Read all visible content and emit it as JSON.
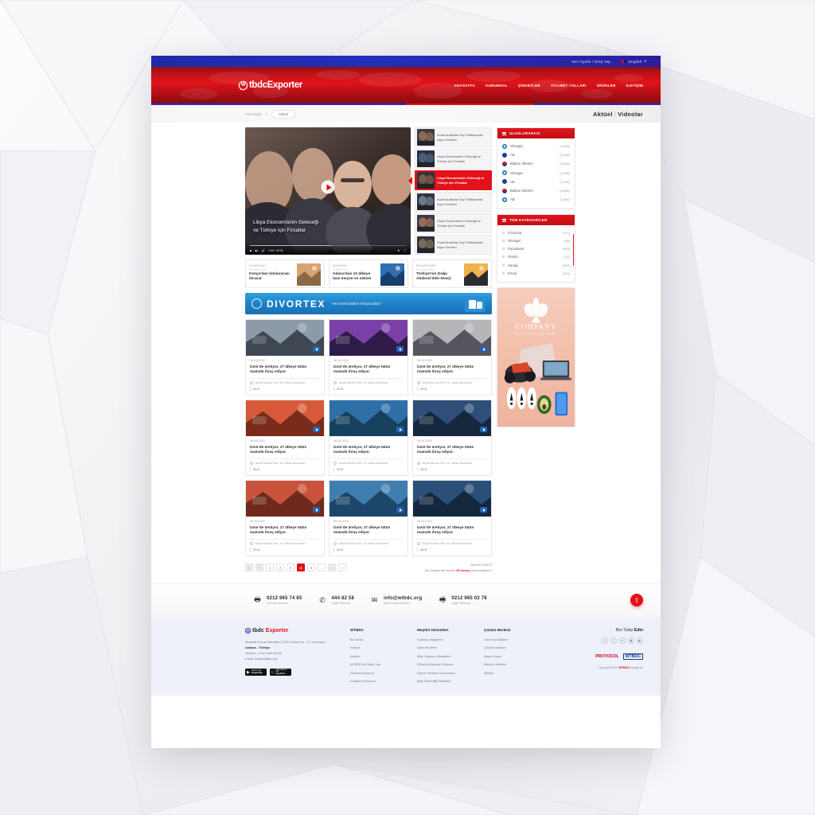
{
  "topbar": {
    "membership": "Yeni Üyelik / Giriş Yap",
    "language": "English",
    "caret": "▾"
  },
  "header": {
    "logo_mark": "W",
    "logo_text": "tbdcExporter",
    "nav": [
      {
        "label": "ANASAYFA"
      },
      {
        "label": "KURUMSAL"
      },
      {
        "label": "ŞİRKETLER"
      },
      {
        "label": "TİCARET YOLLARI"
      },
      {
        "label": "ÜRÜNLER"
      },
      {
        "label": "İLETİŞİM"
      }
    ]
  },
  "breadcrumb": {
    "home": "Ana Sayfa",
    "sep": ">",
    "current": "Aktüel"
  },
  "page_title": {
    "first": "Aktüel",
    "sep": "/",
    "second": "Videolar"
  },
  "player": {
    "title_line1": "Libya Ekonomisinin Geleceği",
    "title_line2": "ve Türkiye için Fırsatlar",
    "time": "1:00 / 40:31",
    "play_icon": "play-icon",
    "next_icon": "▶|",
    "volume_icon": "🔊",
    "settings_icon": "⚙",
    "fullscreen_icon": "⛶"
  },
  "playlist": [
    {
      "title": "Suudi Arabistan Dış Politikasında Asya Yönelimi",
      "active": false
    },
    {
      "title": "Libya Ekonomisinin Geleceği ve Türkiye için Fırsatlar",
      "active": false
    },
    {
      "title": "Libya Ekonomisinin Geleceği ve Türkiye için Fırsatlar",
      "active": true
    },
    {
      "title": "Suudi Arabistan Dış Politikasında Asya Yönelimi",
      "active": false
    },
    {
      "title": "Libya Ekonomisinin Geleceği ve Türkiye için Fırsatlar",
      "active": false
    },
    {
      "title": "Suudi Arabistan Dış Politikasında Asya Yönelimi",
      "active": false
    }
  ],
  "widget_international": {
    "title": "ULUSLARARASI",
    "rows": [
      {
        "label": "Shangai",
        "count": "(2.548)"
      },
      {
        "label": "AB",
        "count": "(1.694)"
      },
      {
        "label": "Balkan Ülkeleri",
        "count": "(9.854)"
      },
      {
        "label": "Shangai",
        "count": "(2.548)"
      },
      {
        "label": "AB",
        "count": "(1.694)"
      },
      {
        "label": "Balkan Ülkeleri",
        "count": "(9.854)"
      },
      {
        "label": "AB",
        "count": "(1.694)"
      }
    ]
  },
  "widget_categories": {
    "title": "TÜM KATEGORİLER",
    "rows": [
      {
        "label": "E-İhracat",
        "count": "(971)"
      },
      {
        "label": "Shangai",
        "count": "(26)"
      },
      {
        "label": "Pazarlama",
        "count": "(942)"
      },
      {
        "label": "Üretim",
        "count": "(14)"
      },
      {
        "label": "Sanayi",
        "count": "(657)"
      },
      {
        "label": "Enerji",
        "count": "(325)"
      }
    ]
  },
  "promo_ad": {
    "company": "COMPANY",
    "tagline": "YOUR TAGLINE HERE"
  },
  "highlights": [
    {
      "kicker": "E-İHRACAT",
      "title": "Kenya'dan kıtalararası ihracat"
    },
    {
      "kicker": "SHANGAI",
      "title": "Adana'dan 10 ülkeye taze meyve ve sebze!"
    },
    {
      "kicker": "PAZARLAMA",
      "title": "Türkiye'nin Doğu Akdeniz'deki Enerji"
    }
  ],
  "banner": {
    "brand": "DIVORTEX",
    "slogan": "\"Yeni Nesil Bakım Kimyasalları\""
  },
  "video_cards": [
    {
      "date": "06.06.2022",
      "title": "İzmir'de üretiyor, 27 ülkeye tütün mamulü ihraç ediyor.",
      "author": "İsmail Numan Telci, M. Hakan Bonumcel",
      "watch": "İZLE"
    },
    {
      "date": "06.06.2022",
      "title": "İzmir'de üretiyor, 27 ülkeye tütün mamulü ihraç ediyor.",
      "author": "İsmail Numan Telci, M. Hakan Bonumcel",
      "watch": "İZLE"
    },
    {
      "date": "06.06.2022",
      "title": "İzmir'de üretiyor, 27 ülkeye tütün mamulü ihraç ediyor.",
      "author": "İsmail Numan Telci, M. Hakan Bonumcel",
      "watch": "İZLE"
    },
    {
      "date": "06.06.2022",
      "title": "İzmir'de üretiyor, 27 ülkeye tütün mamulü ihraç ediyor.",
      "author": "İsmail Numan Telci, M. Hakan Bonumcel",
      "watch": "İZLE"
    },
    {
      "date": "06.06.2022",
      "title": "İzmir'de üretiyor, 27 ülkeye tütün mamulü ihraç ediyor.",
      "author": "İsmail Numan Telci, M. Hakan Bonumcel",
      "watch": "İZLE"
    },
    {
      "date": "06.06.2022",
      "title": "İzmir'de üretiyor, 27 ülkeye tütün mamulü ihraç ediyor.",
      "author": "İsmail Numan Telci, M. Hakan Bonumcel",
      "watch": "İZLE"
    },
    {
      "date": "06.06.2022",
      "title": "İzmir'de üretiyor, 27 ülkeye tütün mamulü ihraç ediyor.",
      "author": "İsmail Numan Telci, M. Hakan Bonumcel",
      "watch": "İZLE"
    },
    {
      "date": "06.06.2022",
      "title": "İzmir'de üretiyor, 27 ülkeye tütün mamulü ihraç ediyor.",
      "author": "İsmail Numan Telci, M. Hakan Bonumcel",
      "watch": "İZLE"
    },
    {
      "date": "06.06.2022",
      "title": "İzmir'de üretiyor, 27 ülkeye tütün mamulü ihraç ediyor.",
      "author": "İsmail Numan Telci, M. Hakan Bonumcel",
      "watch": "İZLE"
    }
  ],
  "pagination": {
    "first": "«",
    "prev": "‹",
    "next": "›",
    "last": "»",
    "ellipsis": "…",
    "pages": [
      "1",
      "2",
      "3",
      "4",
      "5"
    ],
    "current": "4",
    "summary_title": "SAYFA ÖZETİ",
    "summary_pre": "Bu kategoride toplam",
    "summary_count": "49 sonuç",
    "summary_post": "bulunmaktadır."
  },
  "contact": [
    {
      "icon": "printer-icon",
      "glyph": "🖶",
      "value": "0212 965 74 85",
      "label": "Fax Numaramız"
    },
    {
      "icon": "phone-icon",
      "glyph": "✆",
      "value": "444 82 58",
      "label": "Çağrı Merkezi"
    },
    {
      "icon": "mail-icon",
      "glyph": "✉",
      "value": "info@wtbdc.org",
      "label": "Mail Destek Sistemi"
    },
    {
      "icon": "fax-icon",
      "glyph": "🖷",
      "value": "0212 965 02 78",
      "label": "Çağrı Merkezi"
    }
  ],
  "scroll_top": {
    "glyph": "⇧",
    "name": "scroll-to-top-button"
  },
  "footer": {
    "logo_mark": "W",
    "logo_text_1": "tbdc",
    "logo_text_2": "Exporter",
    "address_line1": "Mustafa Kemal Mahallesi 2129. Sokak No : 1/1 Çankaya",
    "address_line2": "Ankara - Türkiye",
    "phone": "Telefon: (+312) 568 63 58",
    "email": "Email: info@wtbdc.org",
    "stores": [
      {
        "top": "GET IT ON",
        "name": "Google Play",
        "glyph": "▶"
      },
      {
        "top": "Download on the",
        "name": "App Store",
        "glyph": ""
      }
    ],
    "columns": [
      {
        "title": "WTBDC",
        "links": [
          "Biz Kimiz",
          "Kariyer",
          "İletişim",
          "WTBDC'de Satış Yap",
          "Güvenli Alışveriş",
          "Kullanım Kılavuzu"
        ]
      },
      {
        "title": "Müşteri Hizmetleri",
        "links": [
          "Kullanıcı Bilgilerim",
          "İşlem Rehberi",
          "Bilgi Toplumu Hizmetleri",
          "Güvenli Alışveriş Kılavuzu",
          "Kişisel Verilerin Korunması",
          "Bilgi Güvenliği Politikası"
        ]
      },
      {
        "title": "Çözüm Merkezi",
        "links": [
          "Yatırımcı İlişkileri",
          "Çözüm merkezi",
          "Basın Odası",
          "Bizden Haberler",
          "İletişim"
        ]
      }
    ],
    "follow_pre": "Bizi Takip ",
    "follow_bold": "Edin",
    "socials": [
      {
        "name": "facebook-icon",
        "glyph": "f"
      },
      {
        "name": "twitter-icon",
        "glyph": "t"
      },
      {
        "name": "linkedin-icon",
        "glyph": "in"
      },
      {
        "name": "instagram-icon",
        "glyph": "◉"
      },
      {
        "name": "youtube-icon",
        "glyph": "▶"
      }
    ],
    "partner_1": "PROTOCOL",
    "partner_2": "WTBDC",
    "copyright_pre": "Copyright 2022 ",
    "copyright_brand": "WTBDC",
    "copyright_post": " design by"
  },
  "colors": {
    "brand_red": "#e2121a",
    "brand_blue": "#2030bb",
    "footer_bg": "#eef0fa",
    "banner_blue": "#1d7fc6"
  }
}
